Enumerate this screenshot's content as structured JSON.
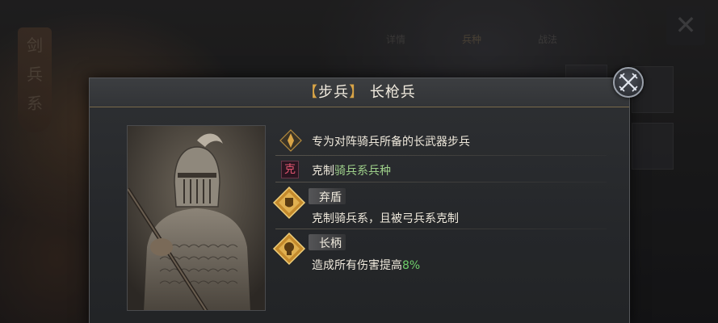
{
  "background": {
    "banner_text": [
      "剑",
      "兵",
      "系"
    ],
    "tabs": [
      {
        "label": "详情",
        "active": false
      },
      {
        "label": "兵种",
        "active": true
      },
      {
        "label": "战法",
        "active": false
      }
    ]
  },
  "popup": {
    "title_open": "【",
    "title_type": "步兵",
    "title_close": "】",
    "title_name": "长枪兵",
    "description": "专为对阵骑兵所备的长武器步兵",
    "counter": {
      "badge": "克",
      "prefix": "克制",
      "target": "骑兵系兵种"
    },
    "skills": [
      {
        "name": "弃盾",
        "desc": "克制骑兵系，且被弓兵系克制",
        "desc_value": "",
        "icon": "shield-drop-icon"
      },
      {
        "name": "长柄",
        "desc": "造成所有伤害提高",
        "desc_value": "8%",
        "icon": "long-shaft-icon"
      }
    ]
  },
  "colors": {
    "accent_gold": "#d9a446",
    "highlight_green": "#9ed08a",
    "percent_green": "#6fce6a",
    "counter_red": "#e0556f"
  }
}
